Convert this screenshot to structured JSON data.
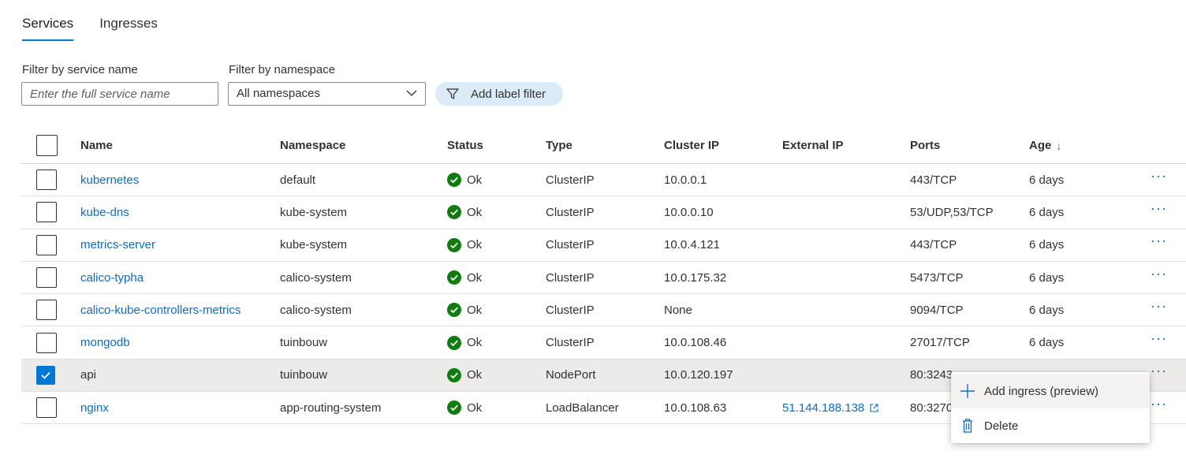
{
  "tabs": [
    {
      "label": "Services"
    },
    {
      "label": "Ingresses"
    }
  ],
  "filters": {
    "service_name_label": "Filter by service name",
    "service_name_placeholder": "Enter the full service name",
    "namespace_label": "Filter by namespace",
    "namespace_value": "All namespaces",
    "add_label_filter": "Add label filter"
  },
  "columns": {
    "name": "Name",
    "namespace": "Namespace",
    "status": "Status",
    "type": "Type",
    "cluster_ip": "Cluster IP",
    "external_ip": "External IP",
    "ports": "Ports",
    "age": "Age",
    "age_sort": "↓"
  },
  "rows": [
    {
      "name": "kubernetes",
      "namespace": "default",
      "status": "Ok",
      "type": "ClusterIP",
      "cluster_ip": "10.0.0.1",
      "external_ip": "",
      "ports": "443/TCP",
      "age": "6 days",
      "more": "···"
    },
    {
      "name": "kube-dns",
      "namespace": "kube-system",
      "status": "Ok",
      "type": "ClusterIP",
      "cluster_ip": "10.0.0.10",
      "external_ip": "",
      "ports": "53/UDP,53/TCP",
      "age": "6 days",
      "more": "···"
    },
    {
      "name": "metrics-server",
      "namespace": "kube-system",
      "status": "Ok",
      "type": "ClusterIP",
      "cluster_ip": "10.0.4.121",
      "external_ip": "",
      "ports": "443/TCP",
      "age": "6 days",
      "more": "···"
    },
    {
      "name": "calico-typha",
      "namespace": "calico-system",
      "status": "Ok",
      "type": "ClusterIP",
      "cluster_ip": "10.0.175.32",
      "external_ip": "",
      "ports": "5473/TCP",
      "age": "6 days",
      "more": "···"
    },
    {
      "name": "calico-kube-controllers-metrics",
      "namespace": "calico-system",
      "status": "Ok",
      "type": "ClusterIP",
      "cluster_ip": "None",
      "external_ip": "",
      "ports": "9094/TCP",
      "age": "6 days",
      "more": "···"
    },
    {
      "name": "mongodb",
      "namespace": "tuinbouw",
      "status": "Ok",
      "type": "ClusterIP",
      "cluster_ip": "10.0.108.46",
      "external_ip": "",
      "ports": "27017/TCP",
      "age": "6 days",
      "more": "···"
    },
    {
      "name": "api",
      "namespace": "tuinbouw",
      "status": "Ok",
      "type": "NodePort",
      "cluster_ip": "10.0.120.197",
      "external_ip": "",
      "ports": "80:3243",
      "age": "",
      "more": "···"
    },
    {
      "name": "nginx",
      "namespace": "app-routing-system",
      "status": "Ok",
      "type": "LoadBalancer",
      "cluster_ip": "10.0.108.63",
      "external_ip": "51.144.188.138",
      "ports": "80:3270",
      "age": "",
      "more": "···"
    }
  ],
  "context_menu": {
    "add_ingress": "Add ingress (preview)",
    "delete": "Delete"
  },
  "colors": {
    "accent": "#0078d4",
    "link": "#0f6cbd",
    "ok_green": "#107c10"
  }
}
